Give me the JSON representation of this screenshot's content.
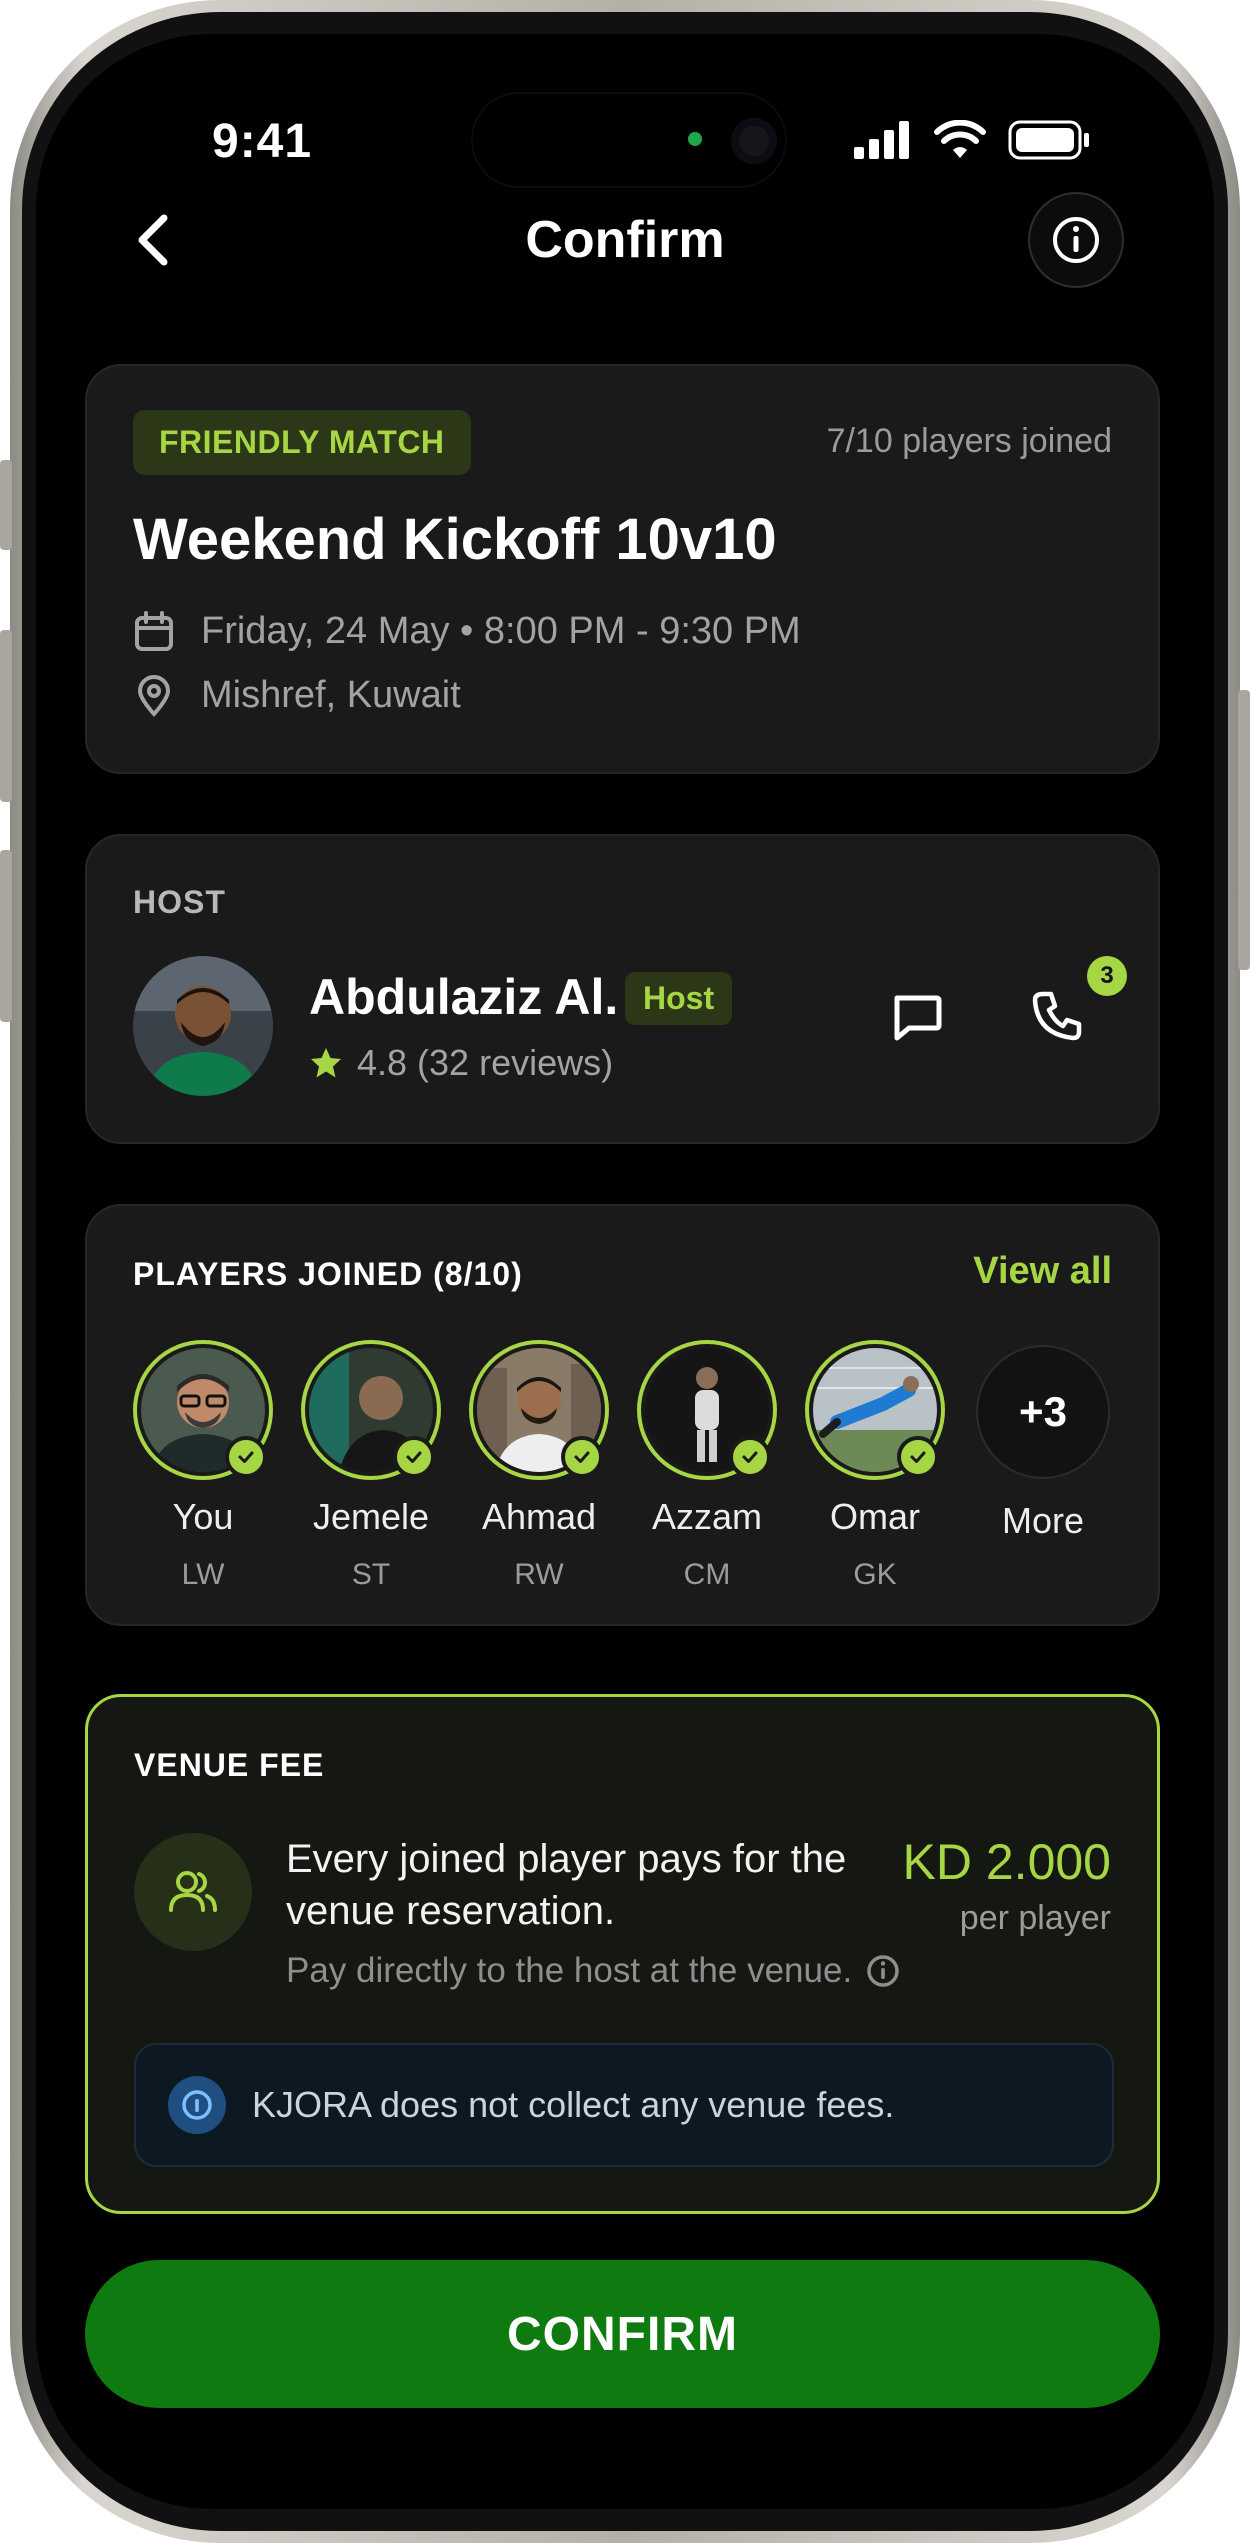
{
  "status_bar": {
    "time": "9:41"
  },
  "nav": {
    "title": "Confirm"
  },
  "match": {
    "badge": "FRIENDLY MATCH",
    "players_joined": "7/10 players joined",
    "title": "Weekend Kickoff 10v10",
    "datetime": "Friday, 24 May • 8:00 PM - 9:30 PM",
    "location": "Mishref, Kuwait"
  },
  "host": {
    "section_label": "HOST",
    "name": "Abdulaziz Al.",
    "badge": "Host",
    "rating": "4.8 (32 reviews)",
    "call_badge_count": "3"
  },
  "players": {
    "section_label": "PLAYERS JOINED (8/10)",
    "view_all": "View all",
    "list": [
      {
        "name": "You",
        "position": "LW"
      },
      {
        "name": "Jemele",
        "position": "ST"
      },
      {
        "name": "Ahmad",
        "position": "RW"
      },
      {
        "name": "Azzam",
        "position": "CM"
      },
      {
        "name": "Omar",
        "position": "GK"
      }
    ],
    "more_count": "+3",
    "more_label": "More"
  },
  "venue": {
    "section_label": "VENUE FEE",
    "description": "Every joined player pays for the venue reservation.",
    "sub_note": "Pay directly to the host at the venue.",
    "price": "KD 2.000",
    "unit": "per player",
    "notice": "KJORA does not collect any venue fees."
  },
  "confirm_label": "CONFIRM",
  "colors": {
    "accent": "#a6d643",
    "confirm": "#0e7a0f",
    "background": "#000000",
    "card": "#1a1a1a"
  }
}
